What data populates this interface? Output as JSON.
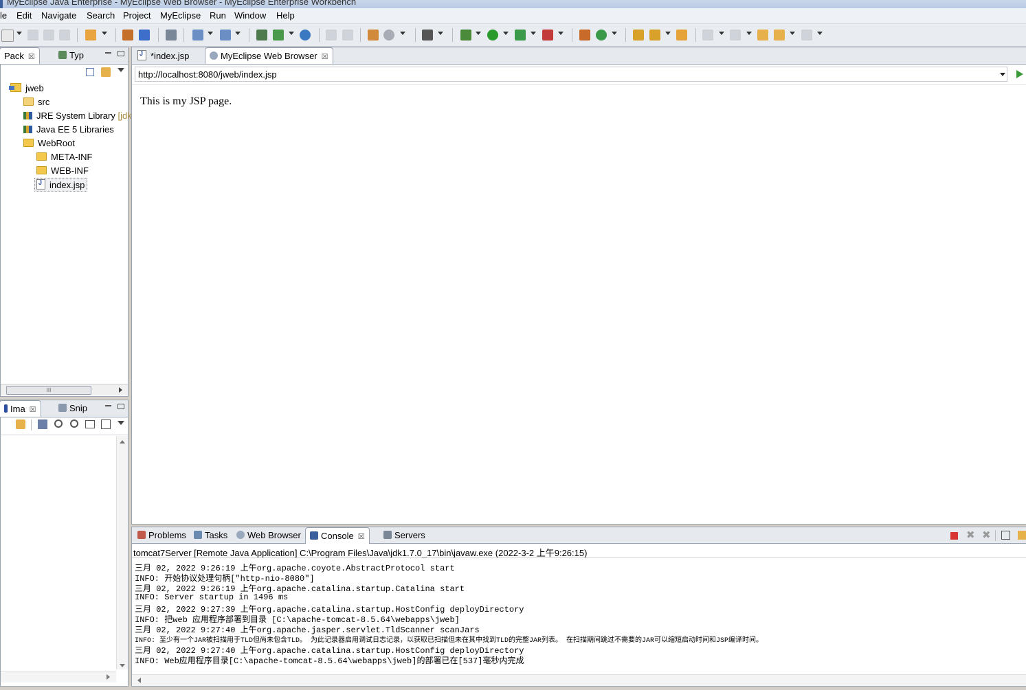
{
  "window": {
    "title": "MyEclipse Java Enterprise - MyEclipse Web Browser - MyEclipse Enterprise Workbench"
  },
  "menu": [
    "le",
    "Edit",
    "Navigate",
    "Search",
    "Project",
    "MyEclipse",
    "Run",
    "Window",
    "Help"
  ],
  "left_top": {
    "tabs": [
      {
        "label": "Pack",
        "close": "☒"
      },
      {
        "label": "Typ"
      }
    ],
    "tree": [
      {
        "label": "jweb",
        "icon": "project-icon"
      },
      {
        "label": "src",
        "icon": "package-folder-icon"
      },
      {
        "label": "JRE System Library",
        "suffix": "[jdk",
        "icon": "library-icon"
      },
      {
        "label": "Java EE 5 Libraries",
        "icon": "library-icon"
      },
      {
        "label": "WebRoot",
        "icon": "folder-icon"
      },
      {
        "label": "META-INF",
        "icon": "folder-icon"
      },
      {
        "label": "WEB-INF",
        "icon": "folder-icon"
      },
      {
        "label": "index.jsp",
        "icon": "jsp-file-icon"
      }
    ],
    "hscroll_grip": "III"
  },
  "left_bottom": {
    "tabs": [
      {
        "label": "Ima",
        "close": "☒"
      },
      {
        "label": "Snip"
      }
    ]
  },
  "editor": {
    "tabs": [
      {
        "label": "*index.jsp"
      },
      {
        "label": "MyEclipse Web Browser",
        "close": "☒"
      }
    ],
    "url": "http://localhost:8080/jweb/index.jsp",
    "page_text": "This is my JSP page."
  },
  "bottom": {
    "tabs": [
      {
        "label": "Problems"
      },
      {
        "label": "Tasks"
      },
      {
        "label": "Web Browser"
      },
      {
        "label": "Console",
        "close": "☒"
      },
      {
        "label": "Servers"
      }
    ],
    "console_header": "tomcat7Server [Remote Java Application] C:\\Program Files\\Java\\jdk1.7.0_17\\bin\\javaw.exe (2022-3-2 上午9:26:15)",
    "console_lines": [
      "三月 02, 2022 9:26:19 上午org.apache.coyote.AbstractProtocol start",
      "INFO: 开始协议处理句柄[\"http-nio-8080\"]",
      "三月 02, 2022 9:26:19 上午org.apache.catalina.startup.Catalina start",
      "INFO: Server startup in 1496 ms",
      "三月 02, 2022 9:27:39 上午org.apache.catalina.startup.HostConfig deployDirectory",
      "INFO: 把web 应用程序部署到目录 [C:\\apache-tomcat-8.5.64\\webapps\\jweb]",
      "三月 02, 2022 9:27:40 上午org.apache.jasper.servlet.TldScanner scanJars",
      "INFO: 至少有一个JAR被扫描用于TLD但尚未包含TLD。 为此记录器启用调试日志记录，以获取已扫描但未在其中找到TLD的完整JAR列表。 在扫描期间跳过不需要的JAR可以缩短启动时间和JSP编译时间。",
      "三月 02, 2022 9:27:40 上午org.apache.catalina.startup.HostConfig deployDirectory",
      "INFO: Web应用程序目录[C:\\apache-tomcat-8.5.64\\webapps\\jweb]的部署已在[537]毫秒内完成"
    ]
  },
  "colors": {
    "accent": "#3a5f9c",
    "panel_border": "#9aa3b2",
    "terminate": "#d93434"
  }
}
